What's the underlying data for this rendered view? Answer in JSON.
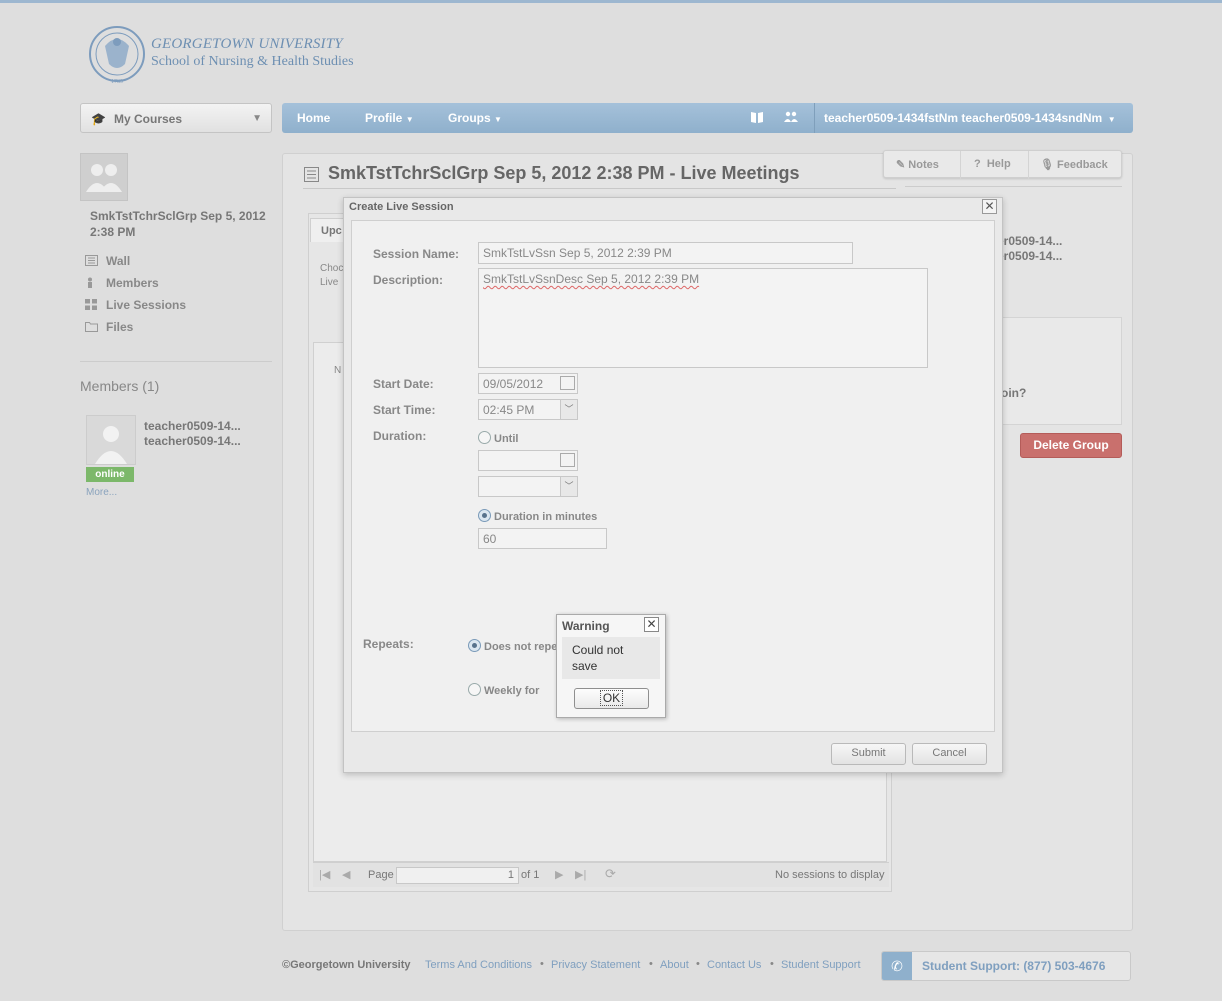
{
  "logo": {
    "line1": "GEORGETOWN UNIVERSITY",
    "line2": "School of Nursing & Health Studies",
    "seal_year": "1789"
  },
  "courses_menu": {
    "label": "My Courses"
  },
  "navbar": {
    "home": "Home",
    "profile": "Profile",
    "groups": "Groups",
    "user": "teacher0509-1434fstNm teacher0509-1434sndNm"
  },
  "left": {
    "group_name": "SmkTstTchrSclGrp Sep 5, 2012 2:38 PM",
    "nav": [
      "Wall",
      "Members",
      "Live Sessions",
      "Files"
    ],
    "members_title": "Members (1)",
    "member_line1": "teacher0509-14...",
    "member_line2": "teacher0509-14...",
    "online": "online",
    "more": "More..."
  },
  "page": {
    "title": "SmkTstTchrSclGrp Sep 5, 2012 2:38 PM - Live Meetings"
  },
  "toolbar": {
    "notes": "Notes",
    "help": "Help",
    "feedback": "Feedback"
  },
  "right": {
    "line1": "er0509-14...",
    "line2": "er0509-14...",
    "join": "oin?",
    "delete": "Delete Group"
  },
  "background": {
    "tab": "Upc",
    "text1": "Choc",
    "text2": "Live",
    "grid_text": "N"
  },
  "pager": {
    "page": "Page",
    "current": "1",
    "of": "of 1",
    "status": "No sessions to display"
  },
  "dialog": {
    "title": "Create Live Session",
    "session_name_label": "Session Name:",
    "session_name": "SmkTstLvSsn Sep 5, 2012 2:39 PM",
    "description_label": "Description:",
    "description": "SmkTstLvSsnDesc Sep 5, 2012 2:39 PM",
    "start_date_label": "Start Date:",
    "start_date": "09/05/2012",
    "start_time_label": "Start Time:",
    "start_time": "02:45 PM",
    "duration_label": "Duration:",
    "until": "Until",
    "duration_minutes_label": "Duration in minutes",
    "duration_minutes": "60",
    "repeats_label": "Repeats:",
    "does_not_repeat": "Does not repe",
    "weekly": "Weekly for",
    "submit": "Submit",
    "cancel": "Cancel"
  },
  "warning": {
    "title": "Warning",
    "line1": "Could not",
    "line2": "save",
    "ok": "OK"
  },
  "footer": {
    "copyright": "©Georgetown University",
    "links": [
      "Terms And Conditions",
      "Privacy Statement",
      "About",
      "Contact Us",
      "Student Support"
    ],
    "support": "Student Support: (877) 503-4676"
  }
}
